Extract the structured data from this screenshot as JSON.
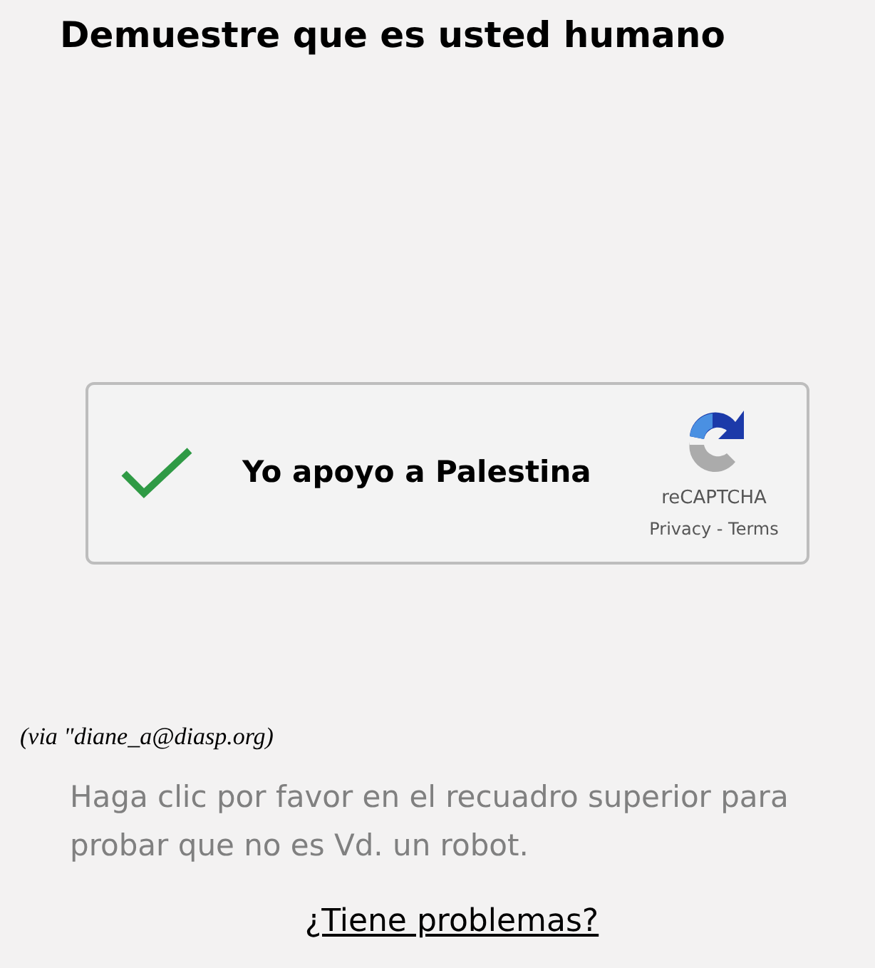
{
  "title": "Demuestre que es usted humano",
  "captcha": {
    "checked": true,
    "label": "Yo apoyo a Palestina",
    "brand": "reCAPTCHA",
    "links": "Privacy - Terms"
  },
  "credit": "(via \"diane_a@diasp.org)",
  "instructions": "Haga clic por favor en el recuadro superior para probar que no es Vd. un robot.",
  "help_link": "¿Tiene problemas?"
}
